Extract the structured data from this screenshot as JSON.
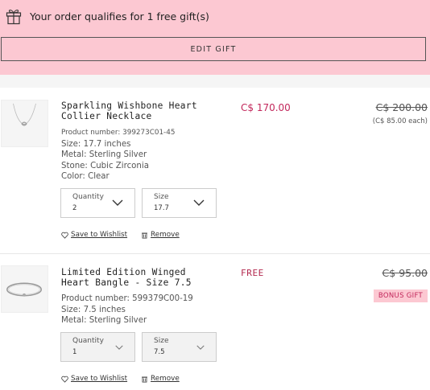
{
  "banner": {
    "message": "Your order qualifies for 1 free gift(s)",
    "edit_label": "EDIT GIFT"
  },
  "items": [
    {
      "title": "Sparkling Wishbone Heart Collier Necklace",
      "product_number": "Product number: 399273C01-45",
      "size_line": "Size: 17.7 inches",
      "metal": "Metal: Sterling Silver",
      "stone": "Stone: Cubic Zirconia",
      "color": "Color: Clear",
      "price": "C$ 170.00",
      "original_price": "C$ 200.00",
      "each": "(C$ 85.00 each)",
      "quantity_label": "Quantity",
      "quantity_value": "2",
      "size_label": "Size",
      "size_value": "17.7",
      "wishlist_label": "Save to Wishlist",
      "remove_label": "Remove"
    },
    {
      "title": "Limited Edition Winged Heart Bangle - Size 7.5",
      "product_number": "Product number: 599379C00-19",
      "size_line": "Size: 7.5 inches",
      "metal": "Metal: Sterling Silver",
      "price": "FREE",
      "original_price": "C$ 95.00",
      "badge": "BONUS GIFT",
      "quantity_label": "Quantity",
      "quantity_value": "1",
      "size_label": "Size",
      "size_value": "7.5",
      "wishlist_label": "Save to Wishlist",
      "remove_label": "Remove"
    }
  ],
  "colors": {
    "banner_bg": "#fcc8d2",
    "accent": "#c2275b"
  }
}
